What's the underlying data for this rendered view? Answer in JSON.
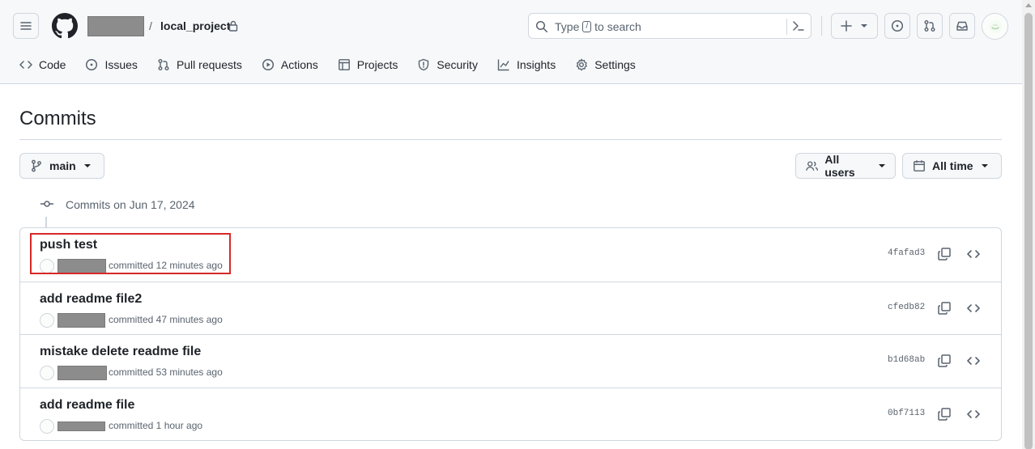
{
  "header": {
    "repo_name": "local_project",
    "breadcrumb_separator": "/",
    "search": {
      "prefix": "Type",
      "key": "/",
      "suffix": "to search"
    }
  },
  "tabs": [
    {
      "label": "Code",
      "icon": "code-icon"
    },
    {
      "label": "Issues",
      "icon": "issue-opened-icon"
    },
    {
      "label": "Pull requests",
      "icon": "git-pull-request-icon"
    },
    {
      "label": "Actions",
      "icon": "play-icon"
    },
    {
      "label": "Projects",
      "icon": "table-icon"
    },
    {
      "label": "Security",
      "icon": "shield-icon"
    },
    {
      "label": "Insights",
      "icon": "graph-icon"
    },
    {
      "label": "Settings",
      "icon": "gear-icon"
    }
  ],
  "page": {
    "title": "Commits",
    "branch_label": "main",
    "users_filter": "All users",
    "time_filter": "All time",
    "group_title": "Commits on Jun 17, 2024"
  },
  "commits": [
    {
      "message": "push test",
      "meta": "committed 12 minutes ago",
      "sha": "4fafad3"
    },
    {
      "message": "add readme file2",
      "meta": "committed 47 minutes ago",
      "sha": "cfedb82"
    },
    {
      "message": "mistake delete readme file",
      "meta": "committed 53 minutes ago",
      "sha": "b1d68ab"
    },
    {
      "message": "add readme file",
      "meta": "committed 1 hour ago",
      "sha": "0bf7113"
    }
  ],
  "colors": {
    "accent_highlight": "#d72828",
    "muted_text": "#59636e",
    "border": "#d0d7de"
  }
}
